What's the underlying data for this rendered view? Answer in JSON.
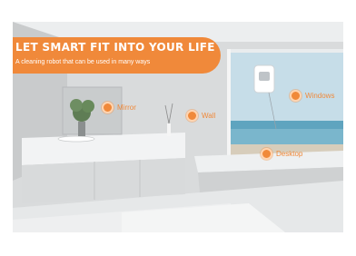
{
  "banner": {
    "title": "LET SMART FIT INTO YOUR LIFE",
    "subtitle": "A cleaning robot that can be used in many ways"
  },
  "hotspots": {
    "mirror": "Mirror",
    "wall": "Wall",
    "windows": "Windows",
    "desktop": "Desktop"
  },
  "colors": {
    "accent": "#f0893a",
    "text_on_accent": "#ffffff"
  }
}
